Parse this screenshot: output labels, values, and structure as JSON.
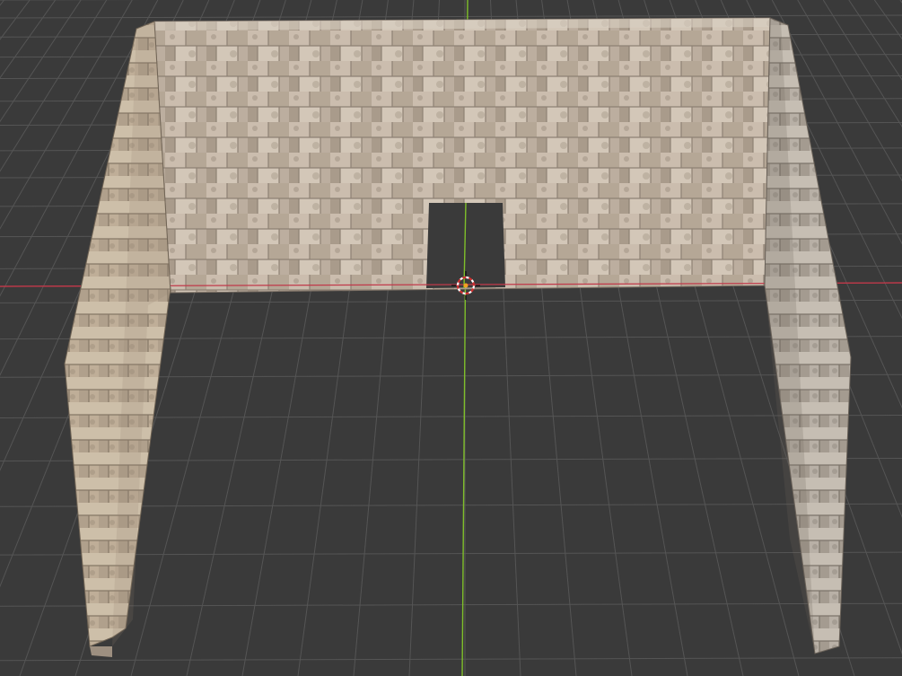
{
  "viewport": {
    "mode": "3d-viewport",
    "shading": "material-preview",
    "background_color": "#3a3a3a",
    "grid_color": "#555555",
    "x_axis_color": "#c0394a",
    "y_axis_color": "#7fbf2a",
    "origin_icon": "3d-cursor-icon"
  },
  "scene": {
    "object": "stone-wall-enclosure",
    "walls": [
      "left-wall",
      "back-wall",
      "right-wall"
    ],
    "back_wall_opening": "doorway",
    "material_colors": [
      "#b9aa9a",
      "#cbbdae",
      "#a89a8b",
      "#d8cdbf"
    ]
  }
}
